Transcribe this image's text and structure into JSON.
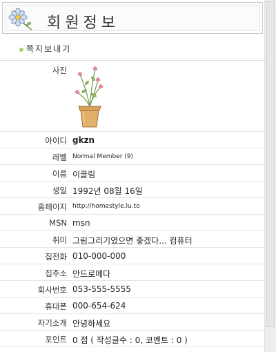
{
  "header": {
    "title": "회원정보"
  },
  "actions": {
    "send_message": "쪽지보내기"
  },
  "profile": {
    "photo_label": "사진",
    "fields": [
      {
        "label": "아이디",
        "value": "gkzn",
        "style": "bold"
      },
      {
        "label": "레벨",
        "value": "Normal Member (9)",
        "style": "small"
      },
      {
        "label": "이름",
        "value": "이끌림"
      },
      {
        "label": "생일",
        "value": "1992년 08월 16일"
      },
      {
        "label": "홈페이지",
        "value": "http://homestyle.lu.to",
        "style": "small"
      },
      {
        "label": "MSN",
        "value": "msn"
      },
      {
        "label": "취미",
        "value": "그림그리기였으면 좋겠다... 컴퓨터"
      },
      {
        "label": "집전화",
        "value": "010-000-000"
      },
      {
        "label": "집주소",
        "value": "안드로메다"
      },
      {
        "label": "회사번호",
        "value": "053-555-5555"
      },
      {
        "label": "휴대폰",
        "value": "000-654-624"
      },
      {
        "label": "자기소개",
        "value": "안녕하세요"
      },
      {
        "label": "포인트",
        "value": "0 점 ( 작성글수 : 0, 코멘트 : 0 )"
      }
    ]
  },
  "colors": {
    "accent": "#9fd06a",
    "divider": "#e4e4e4",
    "pot": "#d9a35a",
    "flower": "#ef8aa8"
  },
  "icons": {
    "header": "flower-icon",
    "photo": "flower-pot-image",
    "bullet": "green-dot-icon"
  }
}
